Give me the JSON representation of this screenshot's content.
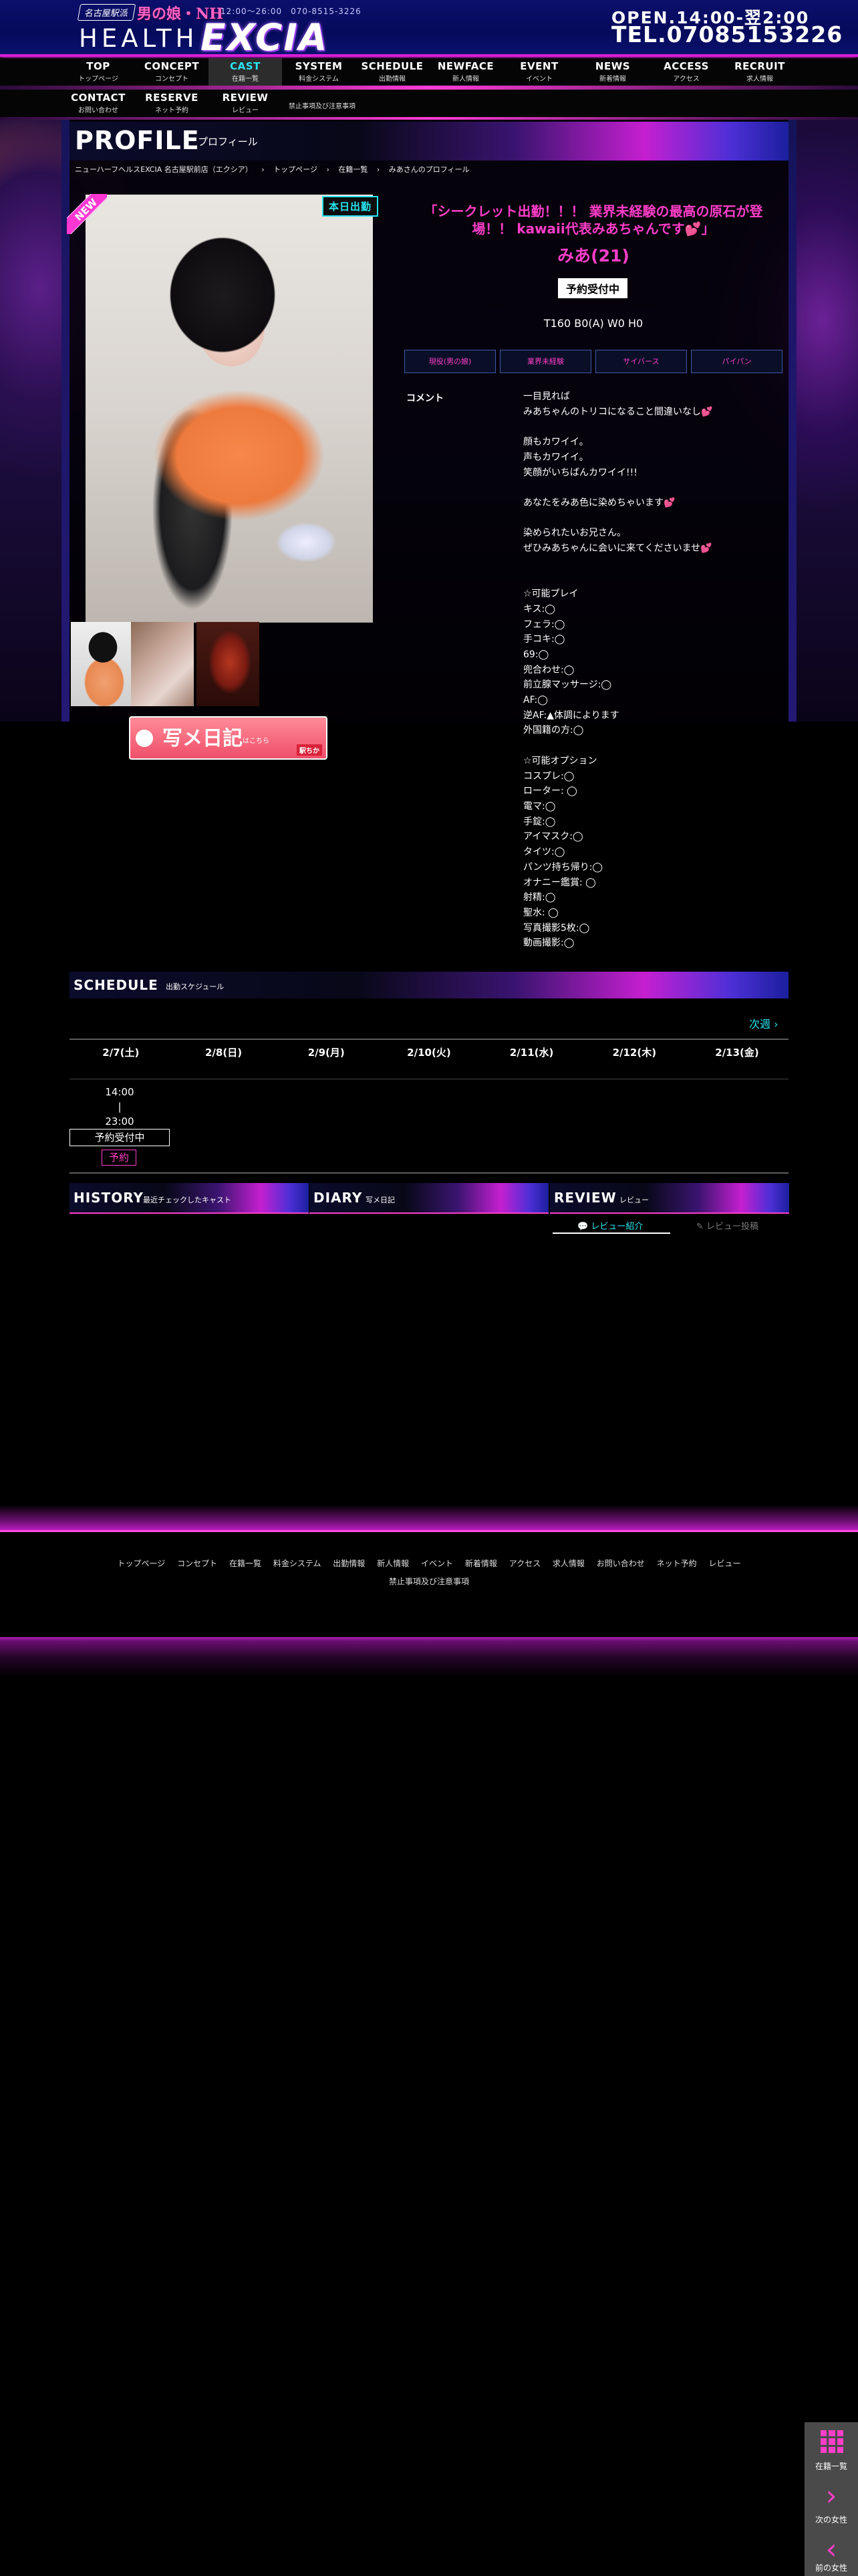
{
  "header": {
    "brand_badge": "名古屋駅派",
    "brand_catch": "男の娘・NH",
    "small_info": "12:00〜26:00　070-8515-3226",
    "brand_health": "HEALTH",
    "brand_excia": "EXCIA",
    "open": "OPEN.14:00-翌2:00",
    "tel": "TEL.07085153226"
  },
  "nav": [
    {
      "en": "TOP",
      "jp": "トップページ"
    },
    {
      "en": "CONCEPT",
      "jp": "コンセプト"
    },
    {
      "en": "CAST",
      "jp": "在籍一覧"
    },
    {
      "en": "SYSTEM",
      "jp": "料金システム"
    },
    {
      "en": "SCHEDULE",
      "jp": "出勤情報"
    },
    {
      "en": "NEWFACE",
      "jp": "新人情報"
    },
    {
      "en": "EVENT",
      "jp": "イベント"
    },
    {
      "en": "NEWS",
      "jp": "新着情報"
    },
    {
      "en": "ACCESS",
      "jp": "アクセス"
    },
    {
      "en": "RECRUIT",
      "jp": "求人情報"
    }
  ],
  "nav2": [
    {
      "en": "CONTACT",
      "jp": "お問い合わせ"
    },
    {
      "en": "RESERVE",
      "jp": "ネット予約"
    },
    {
      "en": "REVIEW",
      "jp": "レビュー"
    }
  ],
  "nav2_banned": "禁止事項及び注意事項",
  "profile": {
    "title": "PROFILE",
    "subtitle": "プロフィール"
  },
  "breadcrumb": [
    "ニューハーフヘルスEXCIA 名古屋駅前店（エクシア）",
    "›",
    "トップページ",
    "›",
    "在籍一覧",
    "›",
    "みあさんのプロフィール"
  ],
  "badges": {
    "new": "NEW",
    "today": "本日出勤"
  },
  "diary_banner": {
    "main": "写メ日記",
    "sub": "はこちら",
    "logo": "駅ちか"
  },
  "cast": {
    "catch": "「シークレット出勤！！！ 業界未経験の最高の原石が登場！！ kawaii代表みあちゃんです💕」",
    "name": "みあ(21)",
    "status": "予約受付中",
    "size": "T160 B0(A) W0 H0",
    "tags": [
      "現役(男の娘)",
      "業界未経験",
      "サイバース",
      "パイパン"
    ]
  },
  "comment": {
    "label": "コメント",
    "body": "一目見れば\nみあちゃんのトリコになること間違いなし💕\n\n顔もカワイイ。\n声もカワイイ。\n笑顔がいちばんカワイイ!!!\n\nあなたをみあ色に染めちゃいます💕\n\n染められたいお兄さん。\nぜひみあちゃんに会いに来てくださいませ💕\n\n\n☆可能プレイ\nキス:◯\nフェラ:◯\n手コキ:◯\n69:◯\n兜合わせ:◯\n前立腺マッサージ:◯\nAF:◯\n逆AF:▲体調によります\n外国籍の方:◯\n\n☆可能オプション\nコスプレ:◯\nローター: ◯\n電マ:◯\n手錠:◯\nアイマスク:◯\nタイツ:◯\nパンツ持ち帰り:◯\nオナニー鑑賞: ◯\n射精:◯\n聖水: ◯\n写真撮影5枚:◯\n動画撮影:◯"
  },
  "schedule": {
    "title": "SCHEDULE",
    "subtitle": "出勤スケジュール",
    "next": "次週 ›",
    "days": [
      "2/7(土)",
      "2/8(日)",
      "2/9(月)",
      "2/10(火)",
      "2/11(水)",
      "2/12(木)",
      "2/13(金)"
    ],
    "slot_time": "14:00\n|\n23:00",
    "slot_status": "予約受付中",
    "slot_reserve": "予約"
  },
  "boxes": {
    "history": {
      "title": "HISTORY",
      "subtitle": "最近チェックしたキャスト"
    },
    "diary": {
      "title": "DIARY",
      "subtitle": "写メ日記"
    },
    "review": {
      "title": "REVIEW",
      "subtitle": "レビュー"
    }
  },
  "review_tabs": {
    "intro": "💬 レビュー紹介",
    "post": "✎ レビュー投稿"
  },
  "footer": {
    "links": [
      "トップページ",
      "コンセプト",
      "在籍一覧",
      "料金システム",
      "出勤情報",
      "新人情報",
      "イベント",
      "新着情報",
      "アクセス",
      "求人情報",
      "お問い合わせ",
      "ネット予約",
      "レビュー"
    ],
    "banned": "禁止事項及び注意事項"
  },
  "float": {
    "list": "在籍一覧",
    "next": "次の女性",
    "prev": "前の女性"
  },
  "colors": {
    "accent_pink": "#ff3ec9",
    "accent_cyan": "#26e6f2",
    "header_blue": "#060a5c"
  }
}
